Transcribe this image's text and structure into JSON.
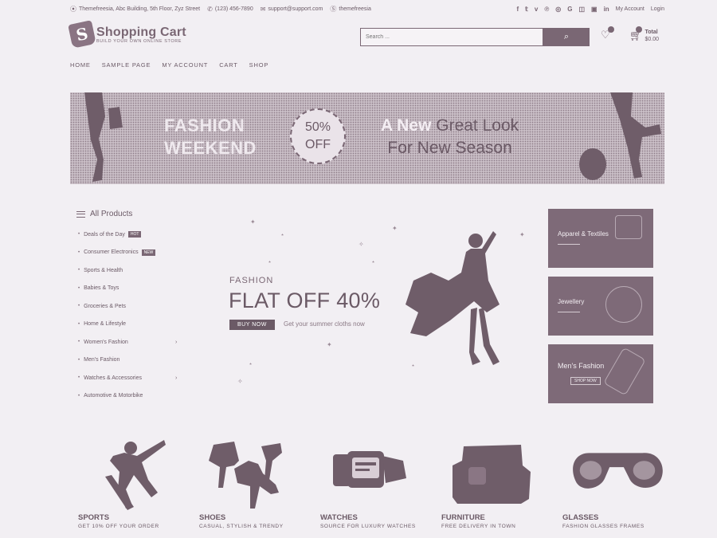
{
  "topbar": {
    "address": "Themefreesia, Abc Building, 5th Floor, Zyz Street",
    "phone": "(123) 456-7890",
    "email": "support@support.com",
    "skype": "themefreesia",
    "my_account": "My Account",
    "login": "Login",
    "social_icons": [
      "facebook-icon",
      "twitter-icon",
      "vimeo-icon",
      "pinterest-icon",
      "dribbble-icon",
      "google-plus-icon",
      "instagram-icon",
      "flickr-icon",
      "linkedin-icon"
    ]
  },
  "header": {
    "logo_letter": "S",
    "logo_title": "Shopping Cart",
    "logo_tagline": "BUILD YOUR OWN ONLINE STORE",
    "search_placeholder": "Search ...",
    "cart_label": "Total",
    "cart_total": "$0.00"
  },
  "nav": {
    "items": [
      "Home",
      "Sample Page",
      "My Account",
      "Cart",
      "Shop"
    ]
  },
  "banner": {
    "left_line1": "FASHION",
    "left_line2": "WEEKEND",
    "discount": "50%",
    "discount_off": "OFF",
    "right_line1_a": "A New",
    "right_line1_b": "Great Look",
    "right_line2": "For New Season"
  },
  "sidebar": {
    "title": "All Products",
    "items": [
      {
        "label": "Deals of the Day",
        "badge": "HOT"
      },
      {
        "label": "Consumer Electronics",
        "badge": "NEW"
      },
      {
        "label": "Sports & Health"
      },
      {
        "label": "Babies & Toys"
      },
      {
        "label": "Groceries & Pets"
      },
      {
        "label": "Home & Lifestyle"
      },
      {
        "label": "Women's Fashion",
        "arrow": "›"
      },
      {
        "label": "Men's Fashion"
      },
      {
        "label": "Watches & Accessories",
        "arrow": "›"
      },
      {
        "label": "Automotive & Motorbike"
      }
    ]
  },
  "hero": {
    "kicker": "FASHION",
    "headline": "FLAT OFF 40%",
    "button": "BUY NOW",
    "subtext": "Get your summer cloths now"
  },
  "promo_tiles": [
    {
      "label": "Apparel & Textiles"
    },
    {
      "label": "Jewellery"
    },
    {
      "label": "Men's Fashion",
      "button": "SHOP NOW"
    }
  ],
  "categories": [
    {
      "title": "SPORTS",
      "subtitle": "GET 10% OFF YOUR ORDER"
    },
    {
      "title": "SHOES",
      "subtitle": "CASUAL, STYLISH & TRENDY"
    },
    {
      "title": "WATCHES",
      "subtitle": "SOURCE FOR LUXURY WATCHES"
    },
    {
      "title": "FURNITURE",
      "subtitle": "FREE DELIVERY IN TOWN"
    },
    {
      "title": "GLASSES",
      "subtitle": "FASHION GLASSES FRAMES"
    }
  ]
}
